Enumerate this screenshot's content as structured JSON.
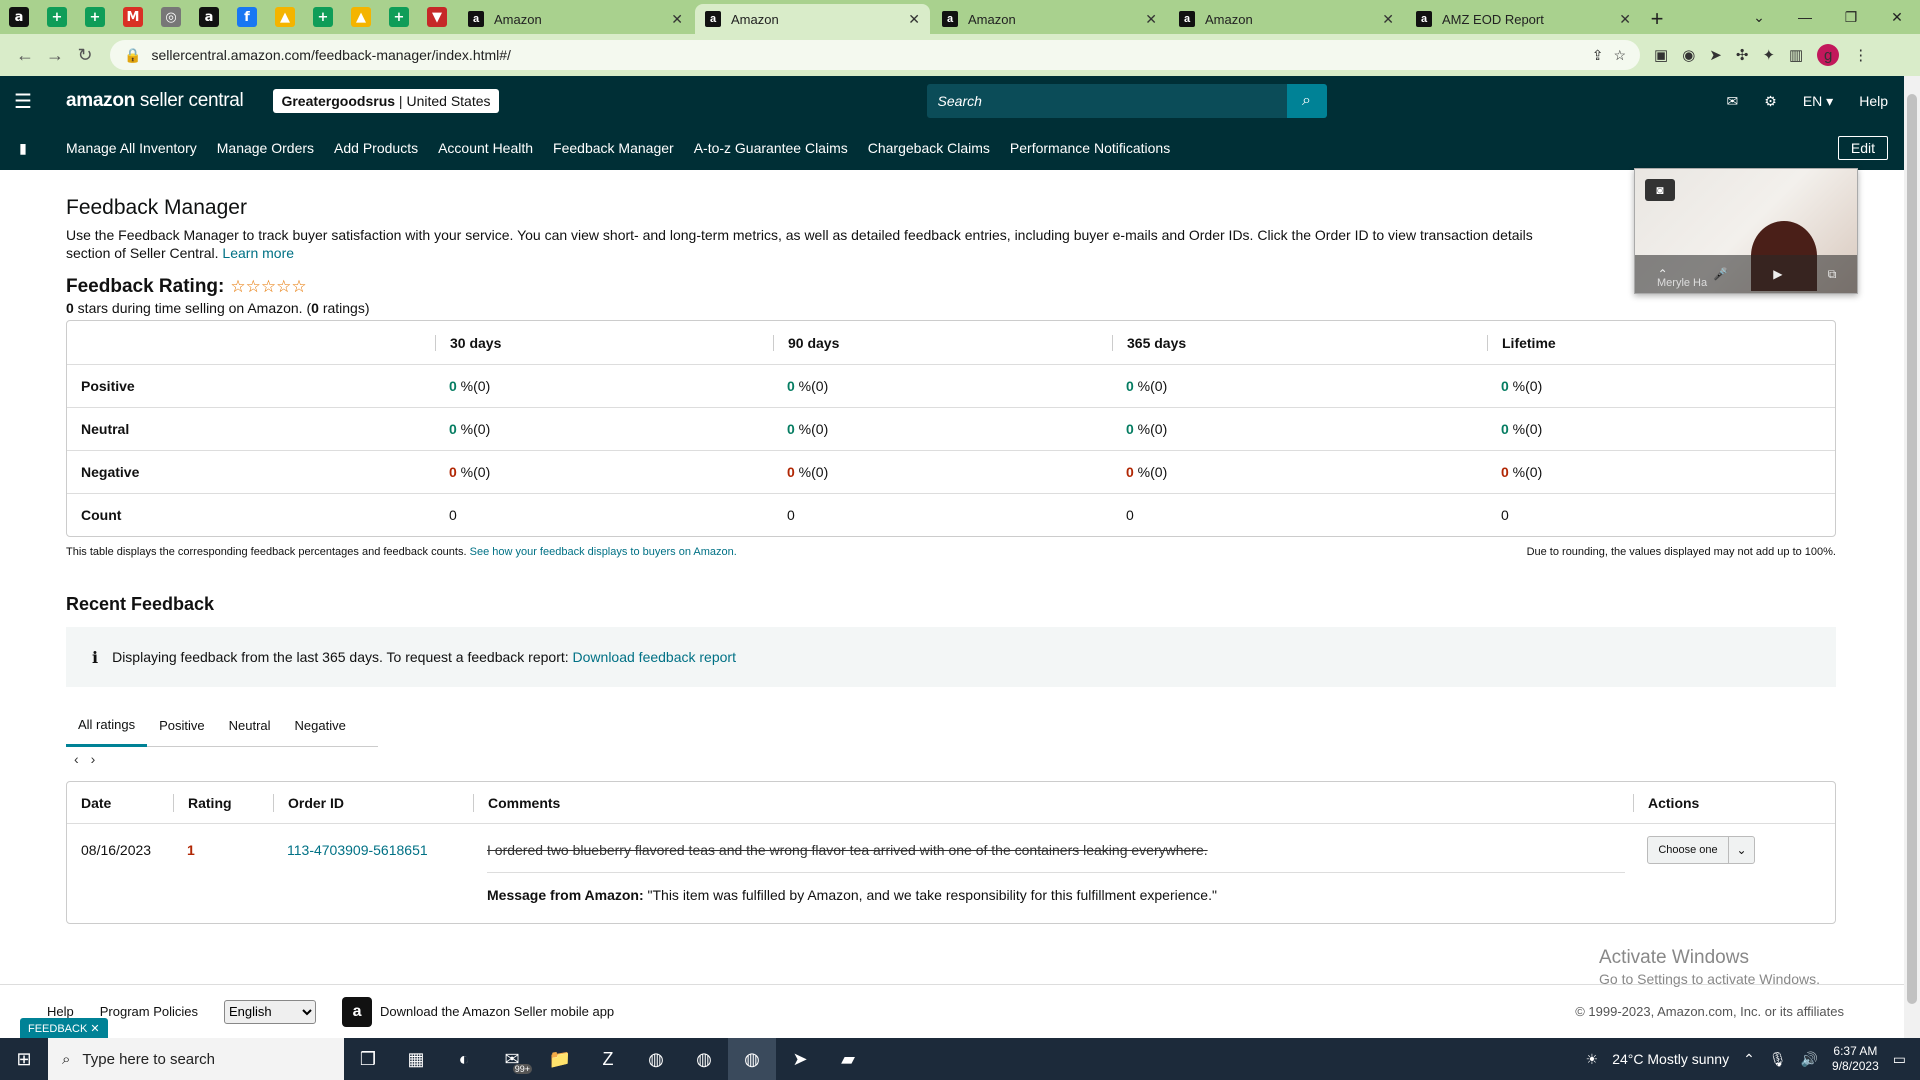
{
  "browser": {
    "mini_tabs": [
      {
        "icon": "amazon-icon",
        "glyph": "a",
        "color": "#111111"
      },
      {
        "icon": "sheets-icon",
        "glyph": "+",
        "color": "#0f9d58"
      },
      {
        "icon": "sheets-icon",
        "glyph": "+",
        "color": "#0f9d58"
      },
      {
        "icon": "gmail-icon",
        "glyph": "M",
        "color": "#d93025"
      },
      {
        "icon": "globe-icon",
        "glyph": "◎",
        "color": "#777777"
      },
      {
        "icon": "amazon-icon",
        "glyph": "a",
        "color": "#111111"
      },
      {
        "icon": "facebook-icon",
        "glyph": "f",
        "color": "#1877f2"
      },
      {
        "icon": "drive-icon",
        "glyph": "▲",
        "color": "#f4b400"
      },
      {
        "icon": "sheets-icon",
        "glyph": "+",
        "color": "#0f9d58"
      },
      {
        "icon": "drive-icon",
        "glyph": "▲",
        "color": "#f4b400"
      },
      {
        "icon": "sheets-icon",
        "glyph": "+",
        "color": "#0f9d58"
      },
      {
        "icon": "shield-icon",
        "glyph": "▼",
        "color": "#c62828"
      }
    ],
    "tabs": [
      {
        "title": "Amazon",
        "active": false
      },
      {
        "title": "Amazon",
        "active": true
      },
      {
        "title": "Amazon",
        "active": false
      },
      {
        "title": "Amazon",
        "active": false
      },
      {
        "title": "AMZ EOD Report",
        "active": false
      }
    ],
    "url": "sellercentral.amazon.com/feedback-manager/index.html#/"
  },
  "header": {
    "brand_bold": "amazon",
    "brand_light": " seller central",
    "store_name": "Greatergoodsrus",
    "store_region": "United States",
    "search_placeholder": "Search",
    "language": "EN",
    "help": "Help"
  },
  "nav": {
    "links": [
      "Manage All Inventory",
      "Manage Orders",
      "Add Products",
      "Account Health",
      "Feedback Manager",
      "A-to-z Guarantee Claims",
      "Chargeback Claims",
      "Performance Notifications"
    ],
    "edit": "Edit"
  },
  "page": {
    "title": "Feedback Manager",
    "intro": "Use the Feedback Manager to track buyer satisfaction with your service. You can view short- and long-term metrics, as well as detailed feedback entries, including buyer e-mails and Order IDs. Click the Order ID to view transaction details",
    "intro_cont": "section of Seller Central.",
    "learn_more": "Learn more",
    "rating_label": "Feedback Rating:",
    "stars_count": "0",
    "stars_text": " stars during time selling on Amazon. (",
    "ratings_count": "0",
    "ratings_text": " ratings)"
  },
  "metrics": {
    "columns": [
      "30 days",
      "90 days",
      "365 days",
      "Lifetime"
    ],
    "rows": [
      {
        "label": "Positive",
        "type": "pct",
        "color": "green",
        "cells": [
          {
            "num": "0",
            "rest": " %(0)"
          },
          {
            "num": "0",
            "rest": " %(0)"
          },
          {
            "num": "0",
            "rest": " %(0)"
          },
          {
            "num": "0",
            "rest": " %(0)"
          }
        ]
      },
      {
        "label": "Neutral",
        "type": "pct",
        "color": "green",
        "cells": [
          {
            "num": "0",
            "rest": " %(0)"
          },
          {
            "num": "0",
            "rest": " %(0)"
          },
          {
            "num": "0",
            "rest": " %(0)"
          },
          {
            "num": "0",
            "rest": " %(0)"
          }
        ]
      },
      {
        "label": "Negative",
        "type": "pct",
        "color": "red",
        "cells": [
          {
            "num": "0",
            "rest": " %(0)"
          },
          {
            "num": "0",
            "rest": " %(0)"
          },
          {
            "num": "0",
            "rest": " %(0)"
          },
          {
            "num": "0",
            "rest": " %(0)"
          }
        ]
      },
      {
        "label": "Count",
        "type": "count",
        "cells": [
          {
            "num": "0"
          },
          {
            "num": "0"
          },
          {
            "num": "0"
          },
          {
            "num": "0"
          }
        ]
      }
    ],
    "note_left": "This table displays the corresponding feedback percentages and feedback counts.",
    "note_link": "See how your feedback displays to buyers on Amazon.",
    "note_right": "Due to rounding, the values displayed may not add up to 100%."
  },
  "recent": {
    "title": "Recent Feedback",
    "banner_text": "Displaying feedback from the last 365 days. To request a feedback report:",
    "banner_link": "Download feedback report",
    "tabs": [
      "All ratings",
      "Positive",
      "Neutral",
      "Negative"
    ],
    "columns": [
      "Date",
      "Rating",
      "Order ID",
      "Comments",
      "Actions"
    ],
    "entry": {
      "date": "08/16/2023",
      "rating": "1",
      "order_id": "113-4703909-5618651",
      "comment": "I ordered two blueberry flavored teas and the wrong flavor tea arrived with one of the containers leaking everywhere.",
      "amazon_label": "Message from Amazon:",
      "amazon_msg": " \"This item was fulfilled by Amazon, and we take responsibility for this fulfillment experience.\"",
      "action": "Choose one"
    }
  },
  "overlay": {
    "pip_name": "Meryle Ha",
    "watermark_title": "Activate Windows",
    "watermark_sub": "Go to Settings to activate Windows."
  },
  "footer": {
    "help": "Help",
    "policies": "Program Policies",
    "language": "English",
    "app_text": "Download the Amazon Seller mobile app",
    "copyright": "© 1999-2023, Amazon.com, Inc. or its affiliates",
    "feedback_btn": "FEEDBACK ✕"
  },
  "taskbar": {
    "search_placeholder": "Type here to search",
    "weather": "24°C  Mostly sunny",
    "time": "6:37 AM",
    "date": "9/8/2023",
    "badge": "99+"
  }
}
